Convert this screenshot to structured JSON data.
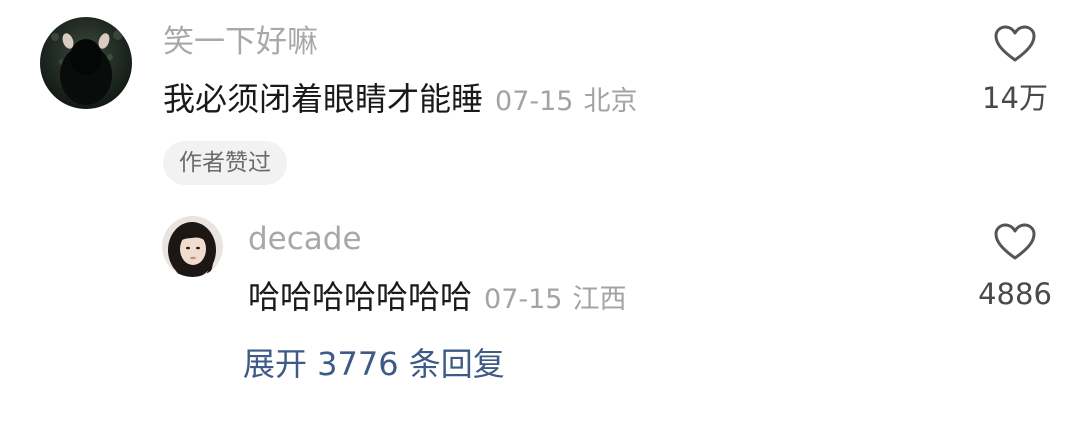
{
  "comment": {
    "username": "笑一下好嘛",
    "text": "我必须闭着眼睛才能睡",
    "date": "07-15",
    "location": "北京",
    "like_count": "14万",
    "author_badge": "作者赞过",
    "avatar_icon": "dark-hooded-figure-avatar",
    "like_icon": "heart-outline-icon"
  },
  "reply": {
    "username": "decade",
    "text": "哈哈哈哈哈哈哈",
    "date": "07-15",
    "location": "江西",
    "like_count": "4886",
    "avatar_icon": "girl-portrait-avatar",
    "like_icon": "heart-outline-icon"
  },
  "expand_replies": {
    "label": "展开 3776 条回复",
    "color": "#3e5a87"
  }
}
